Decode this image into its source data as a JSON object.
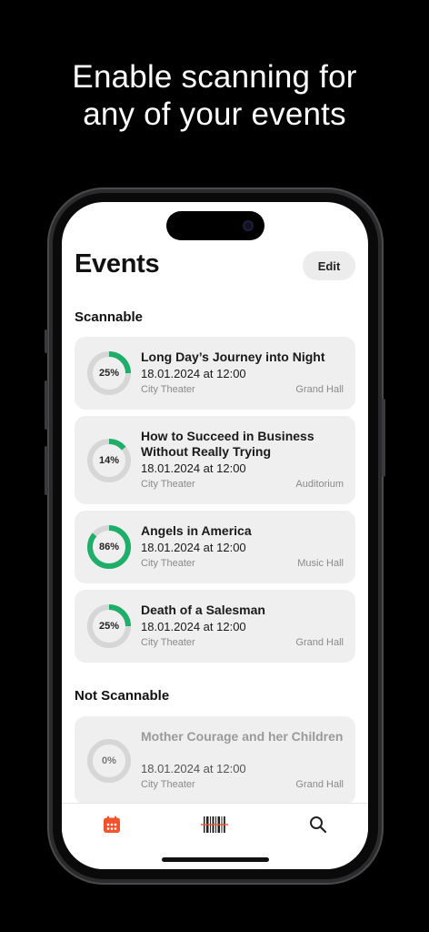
{
  "headline": {
    "line1": "Enable scanning for",
    "line2": "any of your events"
  },
  "header": {
    "title": "Events",
    "edit_label": "Edit"
  },
  "sections": {
    "scannable": "Scannable",
    "not_scannable": "Not Scannable"
  },
  "colors": {
    "progress": "#1fae6a",
    "track": "#d6d6d6",
    "active_tab": "#f2532d"
  },
  "scannable_events": [
    {
      "title": "Long Day’s Journey into Night",
      "progress": 25,
      "progress_label": "25%",
      "datetime": "18.01.2024 at 12:00",
      "venue": "City Theater",
      "room": "Grand Hall"
    },
    {
      "title": "How to Succeed in Business Without Really Trying",
      "progress": 14,
      "progress_label": "14%",
      "datetime": "18.01.2024 at 12:00",
      "venue": "City Theater",
      "room": "Auditorium"
    },
    {
      "title": "Angels in America",
      "progress": 86,
      "progress_label": "86%",
      "datetime": "18.01.2024 at 12:00",
      "venue": "City Theater",
      "room": "Music Hall"
    },
    {
      "title": "Death of a Salesman",
      "progress": 25,
      "progress_label": "25%",
      "datetime": "18.01.2024 at 12:00",
      "venue": "City Theater",
      "room": "Grand Hall"
    }
  ],
  "not_scannable_events": [
    {
      "title": "Mother Courage and her Children",
      "progress": 0,
      "progress_label": "0%",
      "datetime": "18.01.2024 at 12:00",
      "venue": "City Theater",
      "room": "Grand Hall"
    }
  ],
  "tabbar": [
    {
      "icon": "calendar-icon",
      "active": true
    },
    {
      "icon": "barcode-icon",
      "active": false
    },
    {
      "icon": "search-icon",
      "active": false
    }
  ]
}
